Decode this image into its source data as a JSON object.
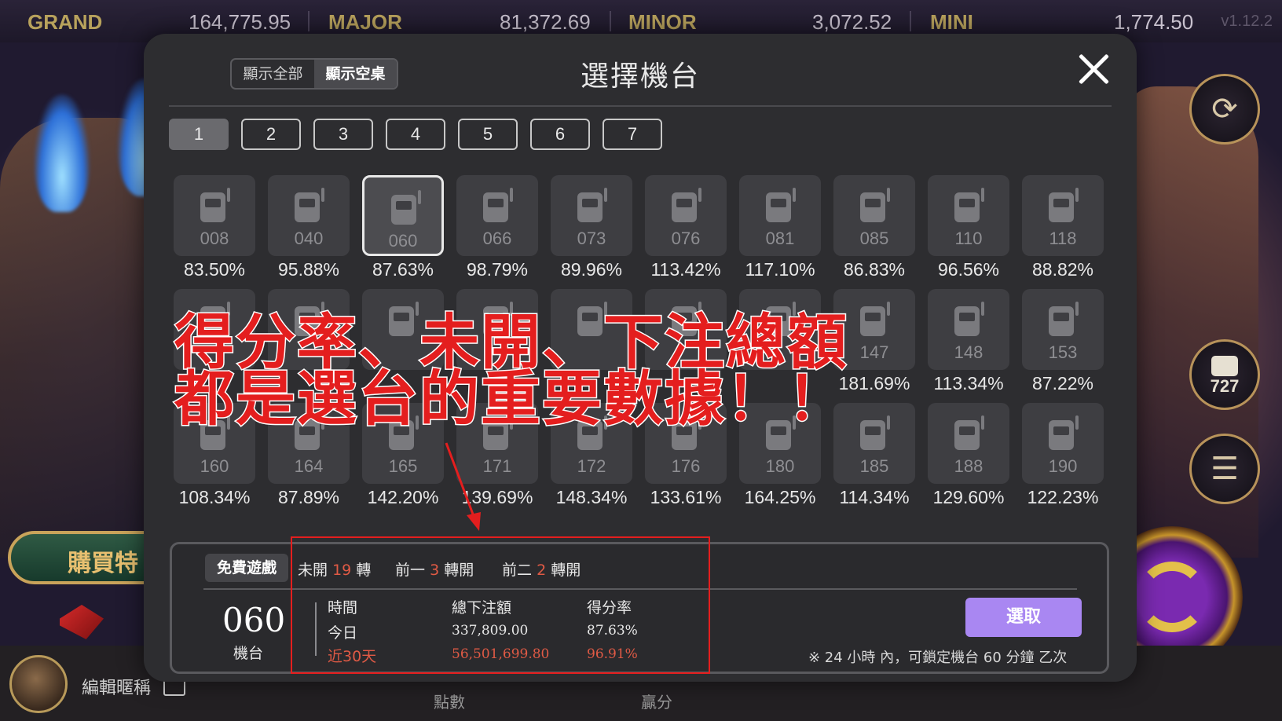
{
  "jackpots": [
    {
      "name": "GRAND",
      "value": "164,775.95"
    },
    {
      "name": "MAJOR",
      "value": "81,372.69"
    },
    {
      "name": "MINOR",
      "value": "3,072.52"
    },
    {
      "name": "MINI",
      "value": "1,774.50"
    }
  ],
  "version": "v1.12.2",
  "side": {
    "machine_count": "727",
    "buy_label": "購買特",
    "nickname": "編輯暱稱",
    "points_label": "點數",
    "win_label": "贏分"
  },
  "modal": {
    "title": "選擇機台",
    "toggle": {
      "all": "顯示全部",
      "empty": "顯示空桌"
    },
    "pages": [
      "1",
      "2",
      "3",
      "4",
      "5",
      "6",
      "7"
    ],
    "active_page": "1",
    "machines": [
      {
        "num": "008",
        "rate": "83.50%"
      },
      {
        "num": "040",
        "rate": "95.88%"
      },
      {
        "num": "060",
        "rate": "87.63%"
      },
      {
        "num": "066",
        "rate": "98.79%"
      },
      {
        "num": "073",
        "rate": "89.96%"
      },
      {
        "num": "076",
        "rate": "113.42%"
      },
      {
        "num": "081",
        "rate": "117.10%"
      },
      {
        "num": "085",
        "rate": "86.83%"
      },
      {
        "num": "110",
        "rate": "96.56%"
      },
      {
        "num": "118",
        "rate": "88.82%"
      },
      {
        "num": "",
        "rate": ""
      },
      {
        "num": "",
        "rate": ""
      },
      {
        "num": "",
        "rate": ""
      },
      {
        "num": "",
        "rate": ""
      },
      {
        "num": "",
        "rate": ""
      },
      {
        "num": "",
        "rate": ""
      },
      {
        "num": "",
        "rate": ""
      },
      {
        "num": "147",
        "rate": "181.69%"
      },
      {
        "num": "148",
        "rate": "113.34%"
      },
      {
        "num": "153",
        "rate": "87.22%"
      },
      {
        "num": "160",
        "rate": "108.34%"
      },
      {
        "num": "164",
        "rate": "87.89%"
      },
      {
        "num": "165",
        "rate": "142.20%"
      },
      {
        "num": "171",
        "rate": "139.69%"
      },
      {
        "num": "172",
        "rate": "148.34%"
      },
      {
        "num": "176",
        "rate": "133.61%"
      },
      {
        "num": "180",
        "rate": "164.25%"
      },
      {
        "num": "185",
        "rate": "114.34%"
      },
      {
        "num": "188",
        "rate": "129.60%"
      },
      {
        "num": "190",
        "rate": "122.23%"
      }
    ],
    "selected_machine": "060",
    "info": {
      "tab": "免費遊戲",
      "unopened": {
        "label": "未開",
        "value": "19",
        "unit": "轉"
      },
      "prev1": {
        "label": "前一",
        "value": "3",
        "unit": "轉開"
      },
      "prev2": {
        "label": "前二",
        "value": "2",
        "unit": "轉開"
      },
      "machine_number": "060",
      "machine_label": "機台",
      "headers": {
        "time": "時間",
        "total_bet": "總下注額",
        "rate": "得分率"
      },
      "today": {
        "time": "今日",
        "total_bet": "337,809.00",
        "rate": "87.63%"
      },
      "last30": {
        "time": "近30天",
        "total_bet": "56,501,699.80",
        "rate": "96.91%"
      },
      "select_label": "選取",
      "note": "※ 24 小時 內，可鎖定機台 60 分鐘 乙次"
    }
  },
  "annotation": {
    "line1": "得分率、未開、下注總額",
    "line2": "都是選台的重要數據！！"
  },
  "colors": {
    "accent_purple": "#a987f2",
    "highlight_red": "#e05a45",
    "annotation_red": "#e41e1e"
  }
}
